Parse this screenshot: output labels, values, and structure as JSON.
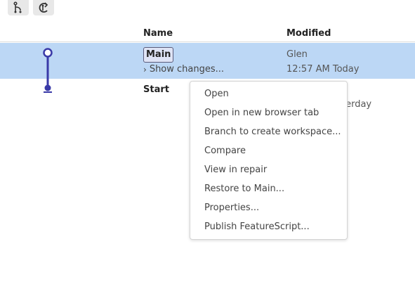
{
  "toolbar": {
    "buttons": [
      {
        "icon": "branch-icon"
      },
      {
        "icon": "compare-icon"
      }
    ]
  },
  "table": {
    "columns": {
      "name": "Name",
      "modified": "Modified"
    }
  },
  "rows": [
    {
      "name": "Main",
      "show_changes": "Show changes...",
      "modified_by": "Glen",
      "modified_time": "12:57 AM Today",
      "selected": true
    },
    {
      "name": "Start",
      "modified_partial": "terday"
    }
  ],
  "context_menu": {
    "items": [
      "Open",
      "Open in new browser tab",
      "Branch to create workspace...",
      "Compare",
      "View in repair",
      "Restore to Main...",
      "Properties...",
      "Publish FeatureScript..."
    ]
  },
  "colors": {
    "selected_row": "#bcd7f5",
    "graph_line": "#3a3aa8",
    "toolbar_button": "#e8e8e8"
  }
}
